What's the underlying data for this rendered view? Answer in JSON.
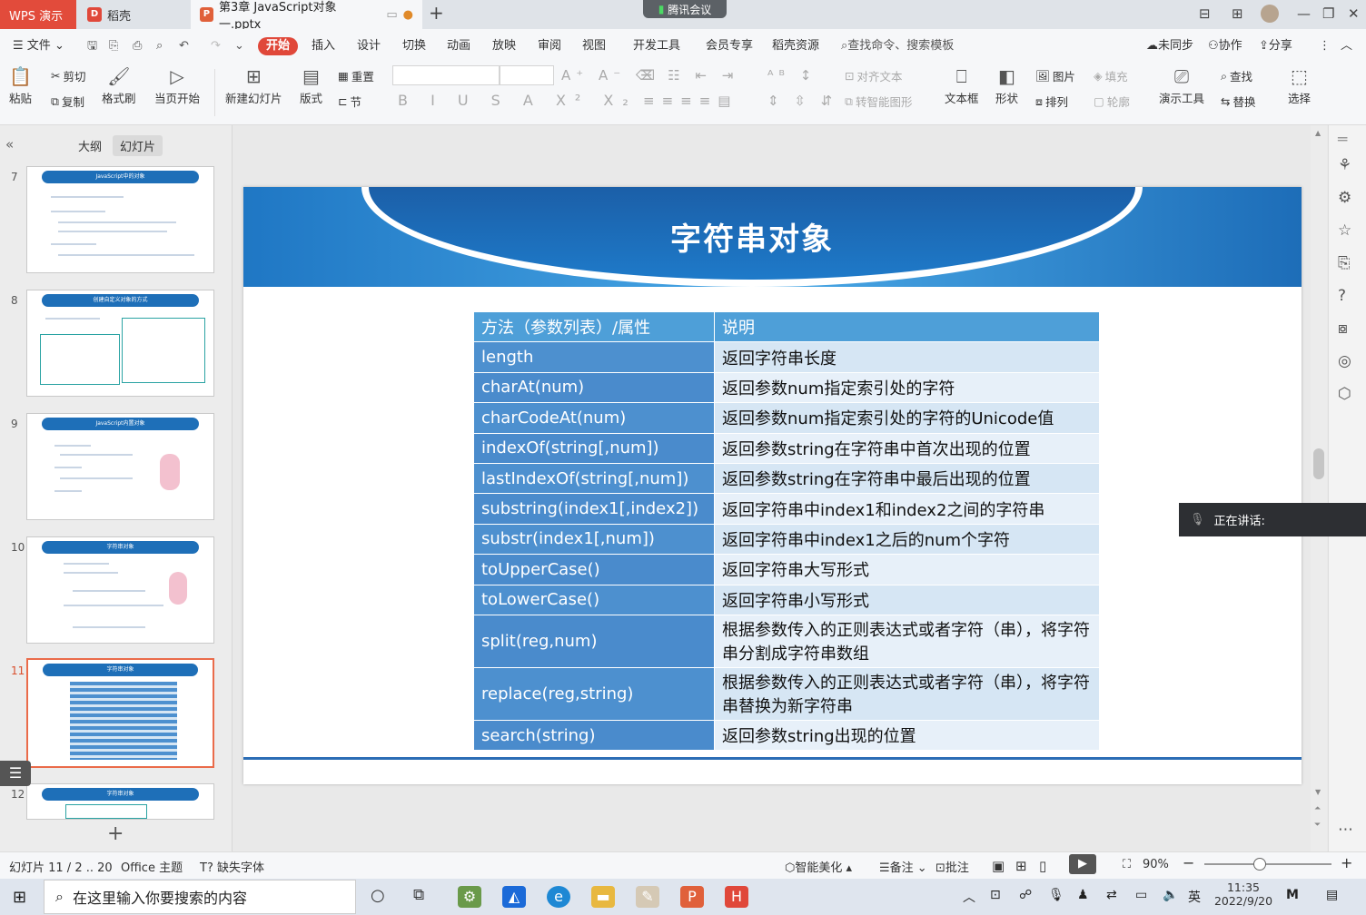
{
  "tabs": {
    "wps": "WPS 演示",
    "daoke": "稻壳",
    "file": "第3章 JavaScript对象一.pptx",
    "meeting": "腾讯会议"
  },
  "menu": {
    "file": "文件",
    "start": "开始",
    "insert": "插入",
    "design": "设计",
    "switch": "切换",
    "animation": "动画",
    "slideshow": "放映",
    "review": "审阅",
    "view": "视图",
    "devtools": "开发工具",
    "member": "会员专享",
    "resources": "稻壳资源",
    "search": "查找命令、搜索模板",
    "unsync": "未同步",
    "collab": "协作",
    "share": "分享"
  },
  "ribbon": {
    "paste": "粘贴",
    "cut": "剪切",
    "copy": "复制",
    "format_painter": "格式刷",
    "from_current": "当页开始",
    "new_slide": "新建幻灯片",
    "layout": "版式",
    "reset": "重置",
    "section": "节",
    "align_text": "对齐文本",
    "smart_shape": "转智能图形",
    "textbox": "文本框",
    "shape": "形状",
    "picture": "图片",
    "arrange": "排列",
    "fill": "填充",
    "outline": "轮廓",
    "present_tools": "演示工具",
    "find": "查找",
    "replace": "替换",
    "select": "选择"
  },
  "panel": {
    "outline_tab": "大纲",
    "slides_tab": "幻灯片"
  },
  "thumbnails": [
    {
      "num": "7",
      "title": "JavaScript中的对象"
    },
    {
      "num": "8",
      "title": "创建自定义对象的方式"
    },
    {
      "num": "9",
      "title": "JavaScript内置对象"
    },
    {
      "num": "10",
      "title": "字符串对象"
    },
    {
      "num": "11",
      "title": "字符串对象"
    },
    {
      "num": "12",
      "title": "字符串对象"
    }
  ],
  "slide": {
    "title": "字符串对象",
    "table": {
      "headers": [
        "方法（参数列表）/属性",
        "说明"
      ],
      "rows": [
        [
          "length",
          "返回字符串长度"
        ],
        [
          "charAt(num)",
          "返回参数num指定索引处的字符"
        ],
        [
          "charCodeAt(num)",
          "返回参数num指定索引处的字符的Unicode值"
        ],
        [
          "indexOf(string[,num])",
          "返回参数string在字符串中首次出现的位置"
        ],
        [
          "lastIndexOf(string[,num])",
          "返回参数string在字符串中最后出现的位置"
        ],
        [
          "substring(index1[,index2])",
          "返回字符串中index1和index2之间的字符串"
        ],
        [
          "substr(index1[,num])",
          "返回字符串中index1之后的num个字符"
        ],
        [
          "toUpperCase()",
          "返回字符串大写形式"
        ],
        [
          "toLowerCase()",
          "返回字符串小写形式"
        ],
        [
          "split(reg,num)",
          "根据参数传入的正则表达式或者字符（串），将字符串分割成字符串数组"
        ],
        [
          "replace(reg,string)",
          "根据参数传入的正则表达式或者字符（串），将字符串替换为新字符串"
        ],
        [
          "search(string)",
          "返回参数string出现的位置"
        ]
      ]
    }
  },
  "speaker": {
    "label": "正在讲话:"
  },
  "status": {
    "slide_info": "幻灯片 11 / 2 .. 20",
    "theme": "Office 主题",
    "missing_font": "缺失字体",
    "beautify": "智能美化",
    "notes": "备注",
    "comment": "批注",
    "zoom": "90%"
  },
  "taskbar": {
    "search_placeholder": "在这里输入你要搜索的内容",
    "time": "11:35",
    "date": "2022/9/20",
    "ime": "英"
  }
}
